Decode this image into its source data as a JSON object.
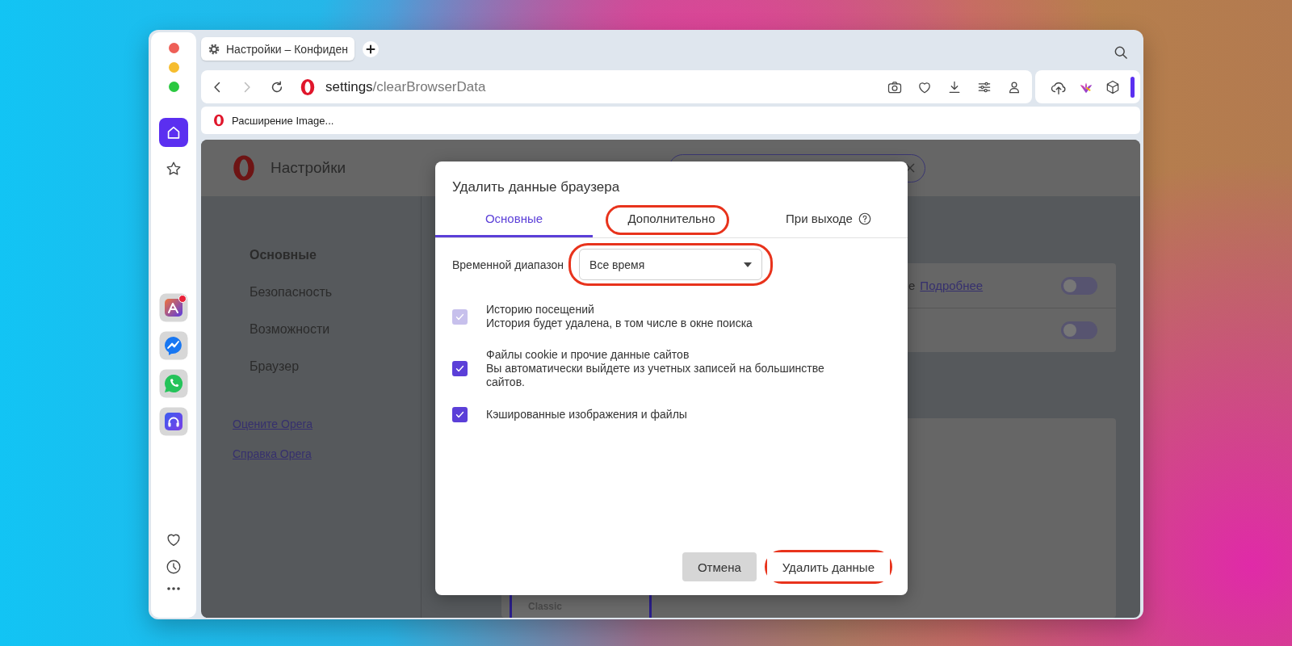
{
  "sidebar": {
    "items": [
      {
        "kind": "home",
        "selected": true,
        "notification": false
      },
      {
        "kind": "star",
        "selected": false,
        "notification": false
      },
      {
        "kind": "spark",
        "selected": false,
        "notification": true
      },
      {
        "kind": "messenger",
        "selected": false,
        "notification": false
      },
      {
        "kind": "whatsapp",
        "selected": false,
        "notification": false
      },
      {
        "kind": "music",
        "selected": false,
        "notification": false
      },
      {
        "kind": "heart",
        "selected": false,
        "notification": false
      },
      {
        "kind": "history",
        "selected": false,
        "notification": false
      },
      {
        "kind": "more",
        "selected": false,
        "notification": false
      }
    ]
  },
  "tabs": [
    {
      "title": "Настройки – Конфиден",
      "selected": true
    }
  ],
  "address_bar": {
    "url_host": "settings",
    "url_path": "/clearBrowserData"
  },
  "bookmarks": [
    {
      "label": "Расширение Image..."
    }
  ],
  "page": {
    "title": "Настройки",
    "nav": [
      {
        "label": "Основные",
        "selected": true
      },
      {
        "label": "Безопасность",
        "selected": false
      },
      {
        "label": "Возможности",
        "selected": false
      },
      {
        "label": "Браузер",
        "selected": false
      }
    ],
    "links": [
      "Оцените Opera",
      "Справка Opera"
    ],
    "settings_rows": [
      {
        "text": "е",
        "link": "Подробнее",
        "on": false
      },
      {
        "on": false
      }
    ],
    "theme_option": {
      "label": "Classic"
    }
  },
  "dialog": {
    "title": "Удалить данные браузера",
    "tabs": [
      {
        "label": "Основные",
        "selected": true,
        "highlighted": false,
        "help": false
      },
      {
        "label": "Дополнительно",
        "selected": false,
        "highlighted": true,
        "help": false
      },
      {
        "label": "При выходе",
        "selected": false,
        "highlighted": false,
        "help": true
      }
    ],
    "time_range": {
      "label": "Временной диапазон",
      "value": "Все время",
      "highlighted": true
    },
    "items": [
      {
        "title": "Историю посещений",
        "description": "История будет удалена, в том числе в окне поиска",
        "checked": true,
        "disabled": true
      },
      {
        "title": "Файлы cookie и прочие данные сайтов",
        "description": "Вы автоматически выйдете из учетных записей на большинстве сайтов.",
        "checked": true,
        "disabled": false
      },
      {
        "title": "Кэшированные изображения и файлы",
        "checked": true,
        "disabled": false
      }
    ],
    "buttons": [
      {
        "label": "Отмена",
        "kind": "secondary",
        "highlighted": false
      },
      {
        "label": "Удалить данные",
        "kind": "primary",
        "highlighted": true
      }
    ]
  }
}
